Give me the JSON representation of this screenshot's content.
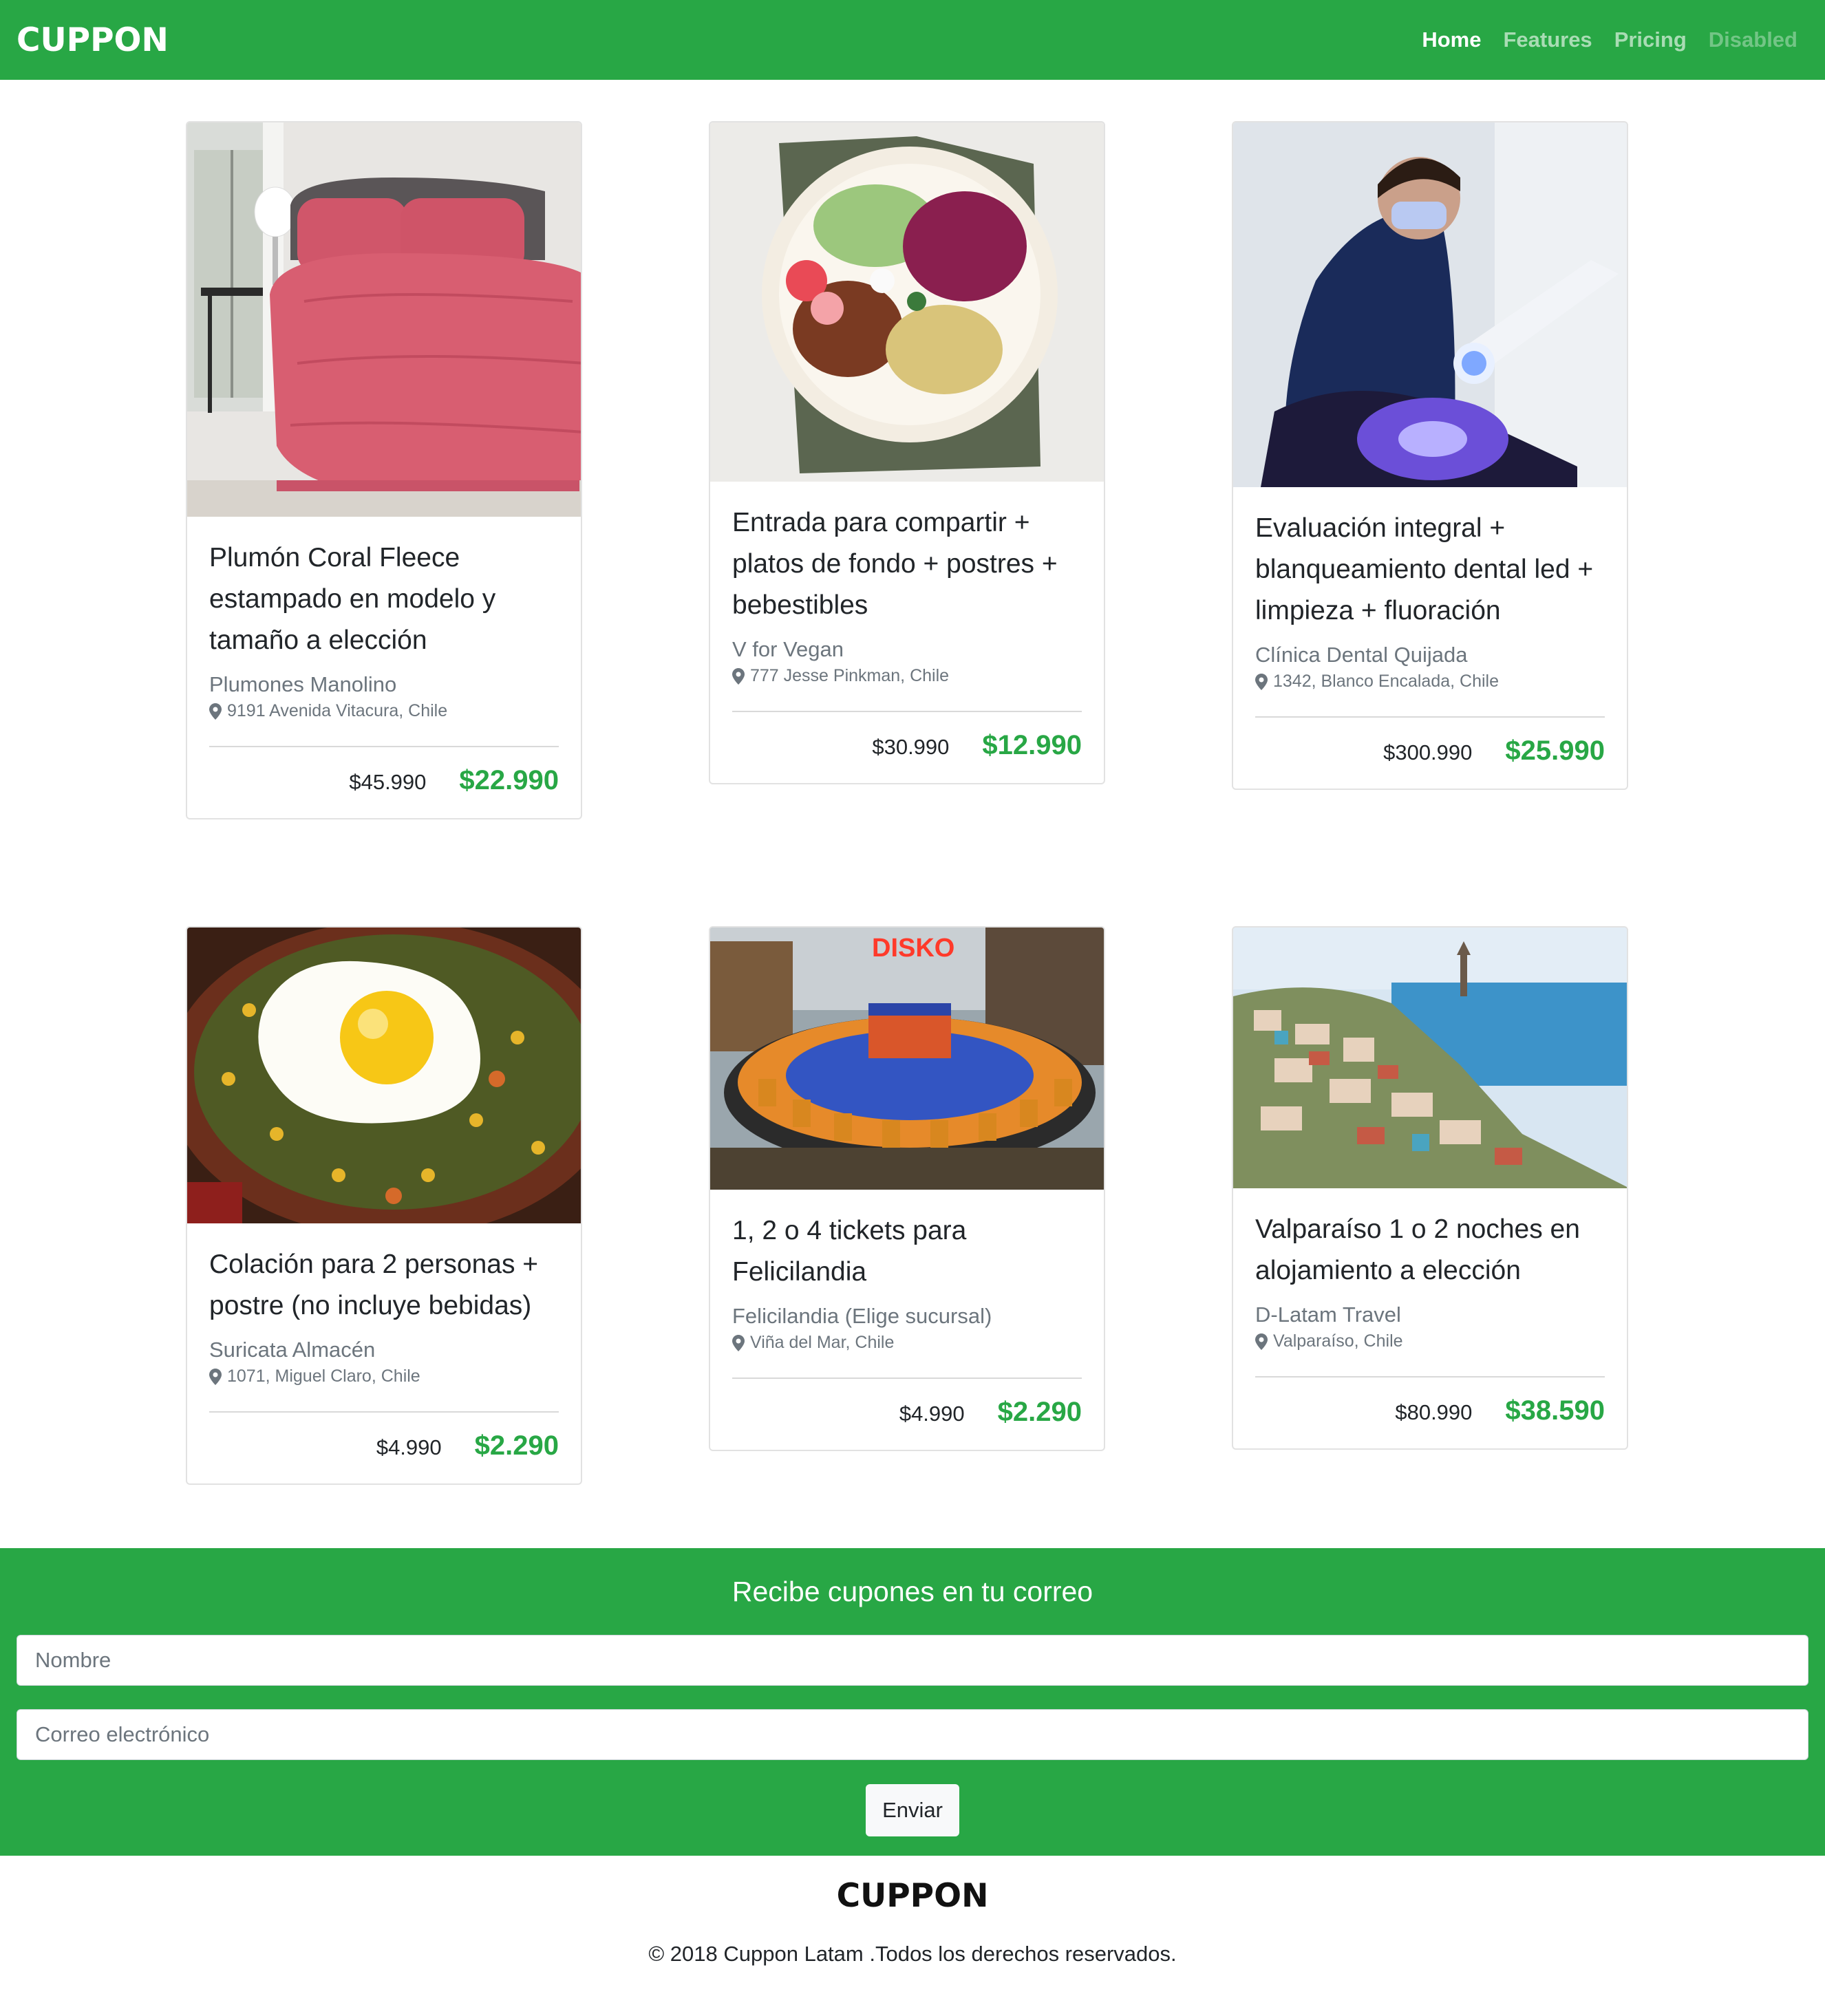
{
  "navbar": {
    "brand": "CUPPON",
    "links": [
      {
        "label": "Home",
        "state": "active"
      },
      {
        "label": "Features",
        "state": "normal"
      },
      {
        "label": "Pricing",
        "state": "normal"
      },
      {
        "label": "Disabled",
        "state": "disabled"
      }
    ]
  },
  "cards": [
    {
      "image": "pink-comforter-bed-image",
      "title": "Plumón Coral Fleece estampado en modelo y tamaño a elección",
      "merchant": "Plumones Manolino",
      "location": "9191 Avenida Vitacura, Chile",
      "old_price": "$45.990",
      "new_price": "$22.990"
    },
    {
      "image": "vegan-bowl-image",
      "title": "Entrada para compartir + platos de fondo + postres + bebestibles",
      "merchant": "V for Vegan",
      "location": "777 Jesse Pinkman, Chile",
      "old_price": "$30.990",
      "new_price": "$12.990"
    },
    {
      "image": "dental-whitening-image",
      "title": "Evaluación integral + blanqueamiento dental led + limpieza + fluoración",
      "merchant": "Clínica Dental Quijada",
      "location": "1342, Blanco Encalada, Chile",
      "old_price": "$300.990",
      "new_price": "$25.990"
    },
    {
      "image": "fried-egg-dish-image",
      "title": "Colación para 2 personas + postre (no incluye bebidas)",
      "merchant": "Suricata Almacén",
      "location": "1071, Miguel Claro, Chile",
      "old_price": "$4.990",
      "new_price": "$2.290"
    },
    {
      "image": "amusement-ride-image",
      "image_text": "DISKO",
      "title": "1, 2 o 4 tickets para Felicilandia",
      "merchant": "Felicilandia (Elige sucursal)",
      "location": "Viña del Mar, Chile",
      "old_price": "$4.990",
      "new_price": "$2.290"
    },
    {
      "image": "valparaiso-city-image",
      "title": "Valparaíso 1 o 2 noches en alojamiento a elección",
      "merchant": "D-Latam Travel",
      "location": "Valparaíso, Chile",
      "old_price": "$80.990",
      "new_price": "$38.590"
    }
  ],
  "newsletter": {
    "title": "Recibe cupones en tu correo",
    "name_placeholder": "Nombre",
    "email_placeholder": "Correo electrónico",
    "submit_label": "Enviar"
  },
  "footer": {
    "brand": "CUPPON",
    "copyright": "© 2018 Cuppon Latam .Todos los derechos reservados."
  },
  "colors": {
    "brand_green": "#28a745",
    "muted_text": "#6c757d"
  }
}
